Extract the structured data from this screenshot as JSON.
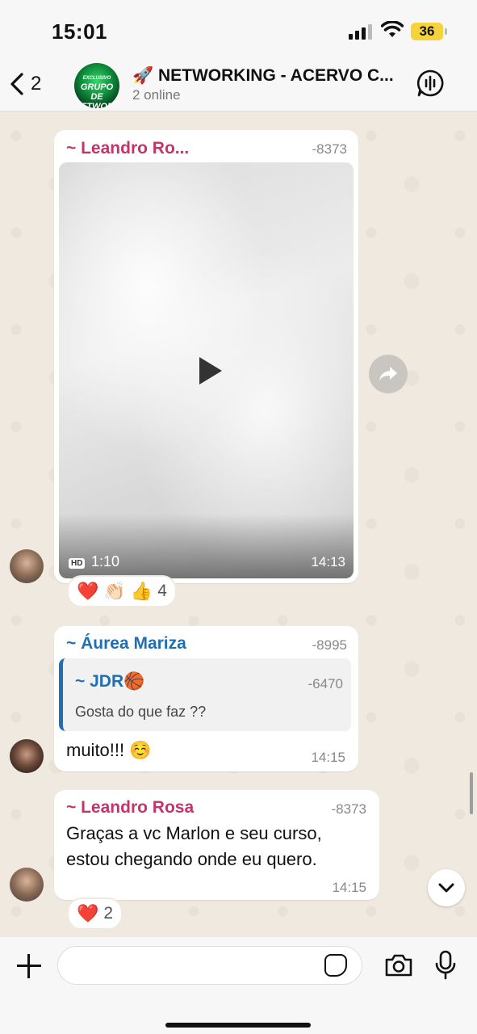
{
  "status_bar": {
    "time": "15:01",
    "battery": "36"
  },
  "header": {
    "back_count": "2",
    "avatar_text": [
      "EXCLUSIVO",
      "GRUPO DE",
      "NETWORK"
    ],
    "title": "🚀 NETWORKING - ACERVO C...",
    "subtitle": "2 online"
  },
  "messages": [
    {
      "sender": "~ Leandro Ro...",
      "phone": "-8373",
      "video": {
        "hd_label": "HD",
        "duration": "1:10",
        "time": "14:13"
      },
      "reactions": {
        "emojis": [
          "❤️",
          "👏🏻",
          "👍"
        ],
        "count": "4"
      }
    },
    {
      "sender": "~ Áurea Mariza",
      "phone": "-8995",
      "quote": {
        "sender": "~ JDR🏀",
        "phone": "-6470",
        "text": "Gosta do que faz ??"
      },
      "text": "muito!!! ☺️",
      "time": "14:15"
    },
    {
      "sender": "~ Leandro Rosa",
      "phone": "-8373",
      "text_lines": [
        "Graças a vc Marlon e seu curso,",
        "estou chegando onde eu quero."
      ],
      "time": "14:15",
      "reactions": {
        "emojis": [
          "❤️"
        ],
        "count": "2"
      }
    }
  ],
  "input": {
    "placeholder": ""
  },
  "colors": {
    "sender_pink": "#c5336b",
    "sender_blue": "#1f6fb3",
    "chat_bg": "#efe9e0"
  }
}
